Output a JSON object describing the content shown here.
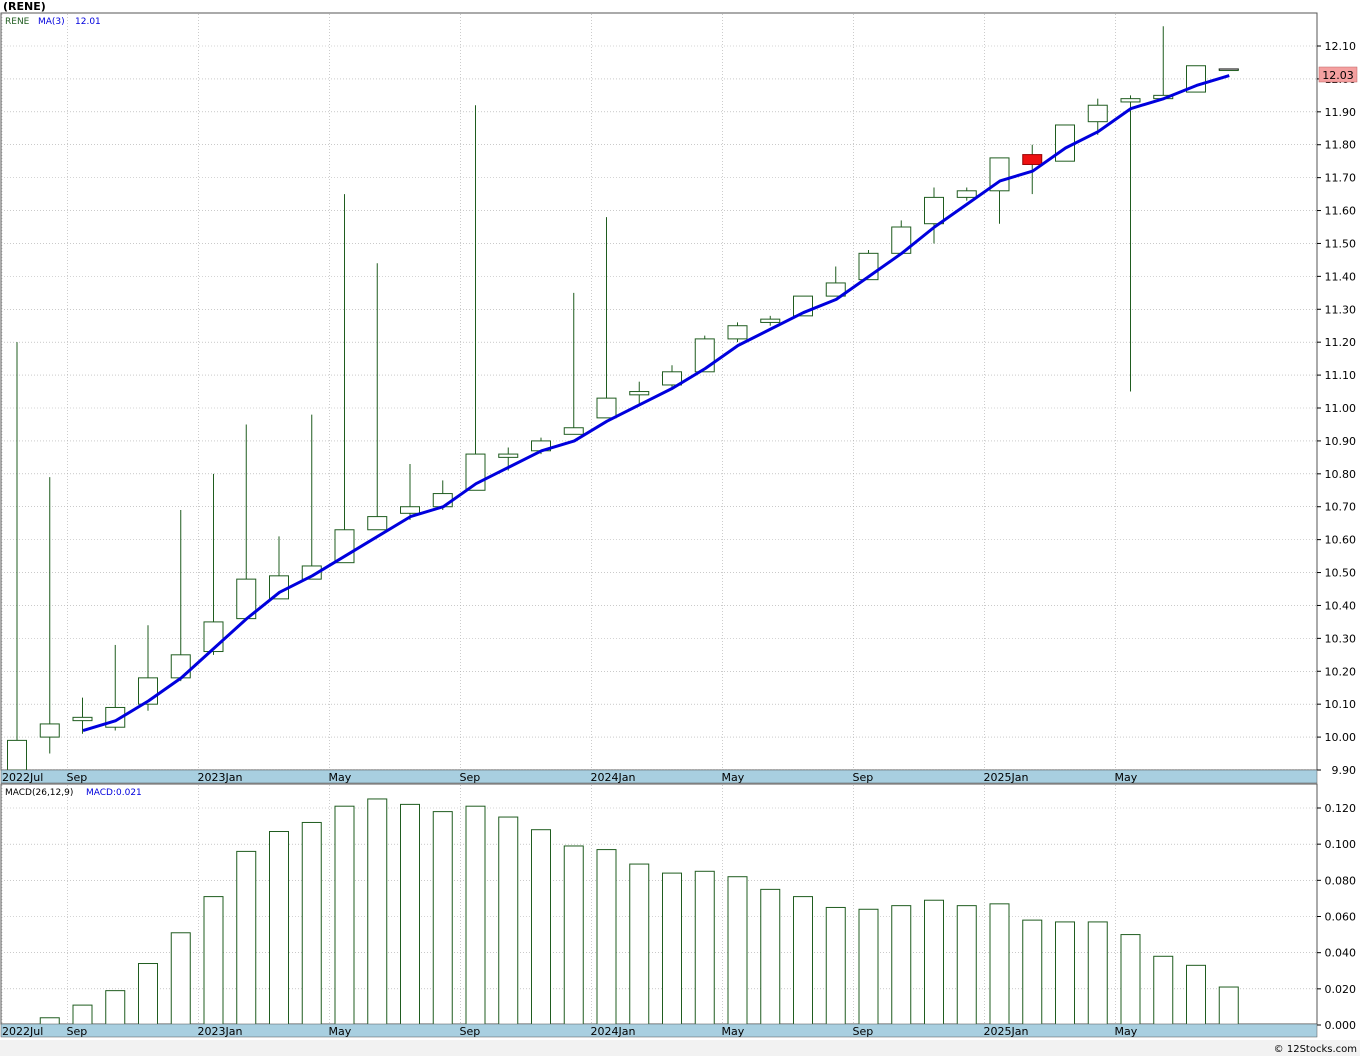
{
  "title": "(RENE)",
  "colors": {
    "candle_up": "#1f5c1f",
    "candle_down_fill": "#ee1111",
    "ma_line": "#0000dd",
    "macd_bar": "#1f5c1f",
    "grid": "#aaaaaa",
    "date_strip": "#a8cfe0",
    "last_price_box": "#f4a0a0"
  },
  "price_panel": {
    "legend": {
      "symbol": "RENE",
      "ma_label": "MA(3)",
      "ma_value": "12.01"
    },
    "last_price_label": "12.03",
    "y_ticks": [
      "12.10",
      "12.00",
      "11.90",
      "11.80",
      "11.70",
      "11.60",
      "11.50",
      "11.40",
      "11.30",
      "11.20",
      "11.10",
      "11.00",
      "10.90",
      "10.80",
      "10.70",
      "10.60",
      "10.50",
      "10.40",
      "10.30",
      "10.20",
      "10.10",
      "10.00",
      "9.90"
    ]
  },
  "macd_panel": {
    "legend": {
      "label": "MACD(26,12,9)",
      "value_label": "MACD:0.021"
    },
    "y_ticks": [
      "0.120",
      "0.100",
      "0.080",
      "0.060",
      "0.040",
      "0.020",
      "0.000"
    ]
  },
  "date_axis": [
    {
      "label": "2022Jul",
      "month_index": 0
    },
    {
      "label": "Sep",
      "month_index": 2
    },
    {
      "label": "2023Jan",
      "month_index": 6
    },
    {
      "label": "May",
      "month_index": 10
    },
    {
      "label": "Sep",
      "month_index": 14
    },
    {
      "label": "2024Jan",
      "month_index": 18
    },
    {
      "label": "May",
      "month_index": 22
    },
    {
      "label": "Sep",
      "month_index": 26
    },
    {
      "label": "2025Jan",
      "month_index": 30
    },
    {
      "label": "May",
      "month_index": 34
    }
  ],
  "footer": "© 12Stocks.com",
  "chart_data": [
    {
      "type": "candlestick",
      "title": "(RENE)",
      "x": [
        "2022Jul",
        "2022Aug",
        "2022Sep",
        "2022Oct",
        "2022Nov",
        "2022Dec",
        "2023Jan",
        "2023Feb",
        "2023Mar",
        "2023Apr",
        "2023May",
        "2023Jun",
        "2023Jul",
        "2023Aug",
        "2023Sep",
        "2023Oct",
        "2023Nov",
        "2023Dec",
        "2024Jan",
        "2024Feb",
        "2024Mar",
        "2024Apr",
        "2024May",
        "2024Jun",
        "2024Jul",
        "2024Aug",
        "2024Sep",
        "2024Oct",
        "2024Nov",
        "2024Dec",
        "2025Jan",
        "2025Feb",
        "2025Mar",
        "2025Apr",
        "2025May",
        "2025Jun",
        "2025Jul",
        "2025Aug"
      ],
      "open": [
        9.9,
        10.0,
        10.05,
        10.03,
        10.1,
        10.18,
        10.26,
        10.36,
        10.42,
        10.48,
        10.53,
        10.63,
        10.68,
        10.7,
        10.75,
        10.85,
        10.87,
        10.92,
        10.97,
        11.04,
        11.07,
        11.11,
        11.21,
        11.26,
        11.28,
        11.34,
        11.39,
        11.47,
        11.56,
        11.64,
        11.66,
        11.77,
        11.75,
        11.87,
        11.93,
        11.94,
        11.96,
        12.03
      ],
      "close": [
        9.99,
        10.04,
        10.06,
        10.09,
        10.18,
        10.25,
        10.35,
        10.48,
        10.49,
        10.52,
        10.63,
        10.67,
        10.7,
        10.74,
        10.86,
        10.86,
        10.9,
        10.94,
        11.03,
        11.05,
        11.11,
        11.21,
        11.25,
        11.27,
        11.34,
        11.38,
        11.47,
        11.55,
        11.64,
        11.66,
        11.76,
        11.74,
        11.86,
        11.92,
        11.94,
        11.95,
        12.04,
        12.03
      ],
      "high": [
        11.2,
        10.79,
        10.12,
        10.28,
        10.34,
        10.69,
        10.8,
        10.95,
        10.61,
        10.98,
        11.65,
        11.44,
        10.83,
        10.78,
        11.92,
        10.88,
        10.91,
        11.35,
        11.58,
        11.08,
        11.13,
        11.22,
        11.26,
        11.28,
        11.34,
        11.43,
        11.48,
        11.57,
        11.67,
        11.67,
        11.76,
        11.8,
        11.86,
        11.94,
        11.95,
        12.16,
        12.04,
        12.03
      ],
      "low": [
        9.9,
        9.95,
        10.01,
        10.02,
        10.08,
        10.17,
        10.25,
        10.36,
        10.42,
        10.48,
        10.53,
        10.63,
        10.66,
        10.69,
        10.75,
        10.81,
        10.86,
        10.92,
        10.97,
        11.01,
        11.06,
        11.11,
        11.2,
        11.25,
        11.28,
        11.34,
        11.39,
        11.47,
        11.5,
        11.63,
        11.56,
        11.65,
        11.75,
        11.83,
        11.05,
        11.94,
        11.96,
        12.03
      ],
      "ma3_x_start": "2022Sep",
      "ma3": [
        10.02,
        10.05,
        10.11,
        10.18,
        10.27,
        10.36,
        10.44,
        10.49,
        10.55,
        10.61,
        10.67,
        10.7,
        10.77,
        10.82,
        10.87,
        10.9,
        10.96,
        11.01,
        11.06,
        11.12,
        11.19,
        11.24,
        11.29,
        11.33,
        11.4,
        11.47,
        11.55,
        11.62,
        11.69,
        11.72,
        11.79,
        11.84,
        11.91,
        11.94,
        11.98,
        12.01
      ],
      "ylim": [
        9.9,
        12.1
      ],
      "last_price": 12.03
    },
    {
      "type": "bar",
      "title": "MACD(26,12,9)",
      "categories": [
        "2022Jul",
        "2022Aug",
        "2022Sep",
        "2022Oct",
        "2022Nov",
        "2022Dec",
        "2023Jan",
        "2023Feb",
        "2023Mar",
        "2023Apr",
        "2023May",
        "2023Jun",
        "2023Jul",
        "2023Aug",
        "2023Sep",
        "2023Oct",
        "2023Nov",
        "2023Dec",
        "2024Jan",
        "2024Feb",
        "2024Mar",
        "2024Apr",
        "2024May",
        "2024Jun",
        "2024Jul",
        "2024Aug",
        "2024Sep",
        "2024Oct",
        "2024Nov",
        "2024Dec",
        "2025Jan",
        "2025Feb",
        "2025Mar",
        "2025Apr",
        "2025May",
        "2025Jun",
        "2025Jul",
        "2025Aug"
      ],
      "values": [
        0.0,
        0.004,
        0.011,
        0.019,
        0.034,
        0.051,
        0.071,
        0.096,
        0.107,
        0.112,
        0.121,
        0.125,
        0.122,
        0.118,
        0.121,
        0.115,
        0.108,
        0.099,
        0.097,
        0.089,
        0.084,
        0.085,
        0.082,
        0.075,
        0.071,
        0.065,
        0.064,
        0.066,
        0.069,
        0.066,
        0.067,
        0.058,
        0.057,
        0.057,
        0.05,
        0.038,
        0.033,
        0.021
      ],
      "ylim": [
        0.0,
        0.125
      ]
    }
  ]
}
